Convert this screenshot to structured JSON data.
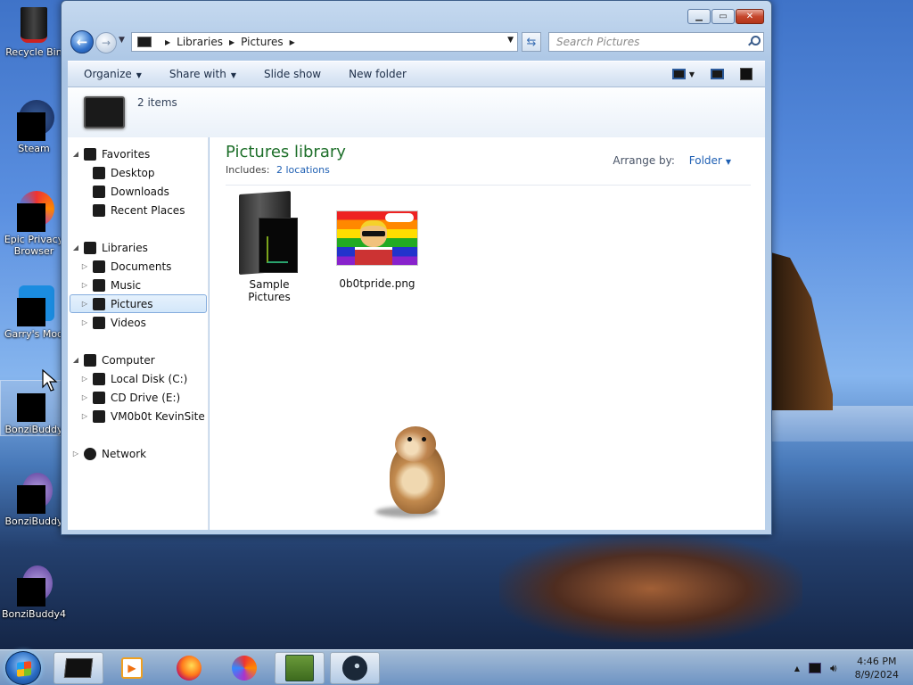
{
  "desktop": {
    "icons": [
      {
        "label": "Recycle Bin",
        "icon": "recycle-bin-icon"
      },
      {
        "label": "Steam",
        "icon": "steam-icon"
      },
      {
        "label": "Epic Privacy Browser",
        "icon": "epic-browser-icon"
      },
      {
        "label": "Garry's Mod",
        "icon": "garrys-mod-icon"
      },
      {
        "label": "BonziBuddy",
        "icon": "bonzibuddy-icon"
      },
      {
        "label": "BonziBuddy",
        "icon": "bonzibuddy-icon"
      },
      {
        "label": "BonziBuddy4",
        "icon": "bonzibuddy-icon"
      }
    ]
  },
  "window": {
    "controls": {
      "minimize": "▁",
      "maximize": "▭",
      "close": "✕"
    },
    "address": {
      "crumbs": [
        "Libraries",
        "Pictures"
      ]
    },
    "search": {
      "placeholder": "Search Pictures"
    },
    "toolbar": {
      "organize": "Organize",
      "share_with": "Share with",
      "slide_show": "Slide show",
      "new_folder": "New folder"
    },
    "details": {
      "item_count": "2 items"
    },
    "nav": {
      "favorites": {
        "label": "Favorites",
        "items": [
          "Desktop",
          "Downloads",
          "Recent Places"
        ]
      },
      "libraries": {
        "label": "Libraries",
        "items": [
          "Documents",
          "Music",
          "Pictures",
          "Videos"
        ],
        "selected": "Pictures"
      },
      "computer": {
        "label": "Computer",
        "items": [
          "Local Disk (C:)",
          "CD Drive (E:)",
          "VM0b0t KevinSite"
        ]
      },
      "network": {
        "label": "Network"
      }
    },
    "library": {
      "title": "Pictures library",
      "includes_label": "Includes:",
      "includes_link": "2 locations",
      "arrange_label": "Arrange by:",
      "arrange_value": "Folder"
    },
    "files": [
      {
        "name": "Sample Pictures",
        "type": "folder"
      },
      {
        "name": "0b0tpride.png",
        "type": "image"
      }
    ]
  },
  "taskbar": {
    "apps": [
      "explorer-icon",
      "media-player-icon",
      "firefox-icon",
      "epic-browser-icon",
      "bonzi-box-icon",
      "steam-icon"
    ],
    "clock": {
      "time": "4:46 PM",
      "date": "8/9/2024"
    }
  },
  "colors": {
    "library_title": "#1e6f2a",
    "link": "#1e5fb3",
    "window_frame": "#a9c4e4"
  }
}
